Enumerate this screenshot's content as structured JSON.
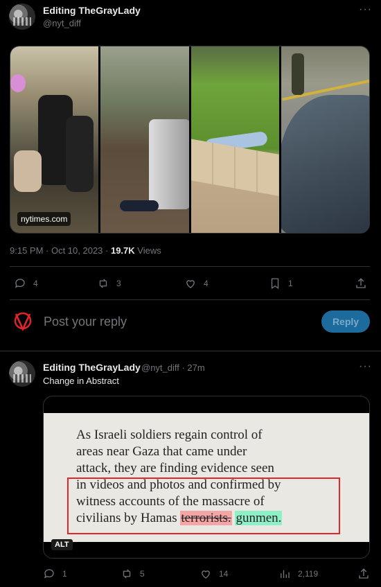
{
  "tweet": {
    "display_name": "Editing TheGrayLady",
    "handle": "@nyt_diff",
    "more_icon": "more-horizontal-icon",
    "media_source": "nytimes.com",
    "time": "9:15 PM · Oct 10, 2023 · ",
    "views_count": "19.7K",
    "views_label": " Views",
    "actions": {
      "replies": "4",
      "retweets": "3",
      "likes": "4",
      "bookmarks": "1"
    }
  },
  "reply_box": {
    "placeholder": "Post your reply",
    "button_label": "Reply",
    "button_color": "#1d6a9c"
  },
  "reply": {
    "display_name": "Editing TheGrayLady",
    "handle_time": "@nyt_diff · 27m",
    "text": "Change in Abstract",
    "doc_lines": [
      "As Israeli soldiers regain control of",
      "areas near Gaza that came under",
      "attack, they are finding evidence seen",
      "in videos and photos and confirmed by",
      "witness accounts of the massacre of",
      "civilians by Hamas "
    ],
    "removed_word": "terrorists.",
    "added_word": "gunmen.",
    "alt_label": "ALT",
    "actions": {
      "replies": "1",
      "retweets": "5",
      "likes": "14",
      "views": "2,119"
    }
  },
  "colors": {
    "background": "#000000",
    "text": "#e7e9ea",
    "muted": "#71767b",
    "removed_highlight": "#f4a6a6",
    "added_highlight": "#8ff0c8",
    "highlight_box": "#e3242b"
  }
}
